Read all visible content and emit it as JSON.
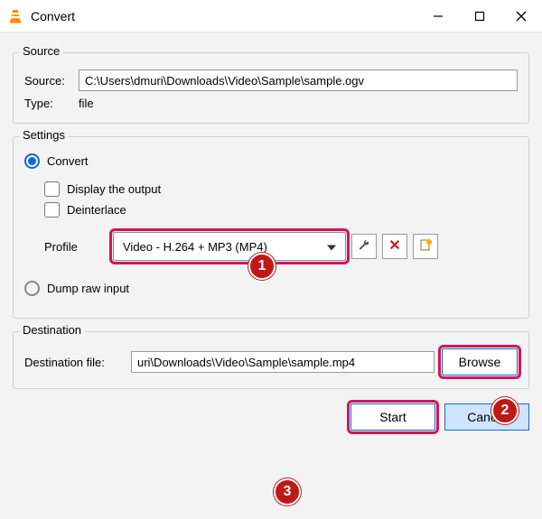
{
  "window": {
    "title": "Convert"
  },
  "source": {
    "group_label": "Source",
    "source_label": "Source:",
    "source_value": "C:\\Users\\dmuri\\Downloads\\Video\\Sample\\sample.ogv",
    "type_label": "Type:",
    "type_value": "file"
  },
  "settings": {
    "group_label": "Settings",
    "convert_label": "Convert",
    "display_output_label": "Display the output",
    "deinterlace_label": "Deinterlace",
    "profile_label": "Profile",
    "profile_value": "Video - H.264 + MP3 (MP4)",
    "dump_raw_label": "Dump raw input"
  },
  "destination": {
    "group_label": "Destination",
    "file_label": "Destination file:",
    "file_value": "uri\\Downloads\\Video\\Sample\\sample.mp4",
    "browse_label": "Browse"
  },
  "buttons": {
    "start": "Start",
    "cancel": "Cancel"
  },
  "annotations": {
    "b1": "1",
    "b2": "2",
    "b3": "3"
  }
}
